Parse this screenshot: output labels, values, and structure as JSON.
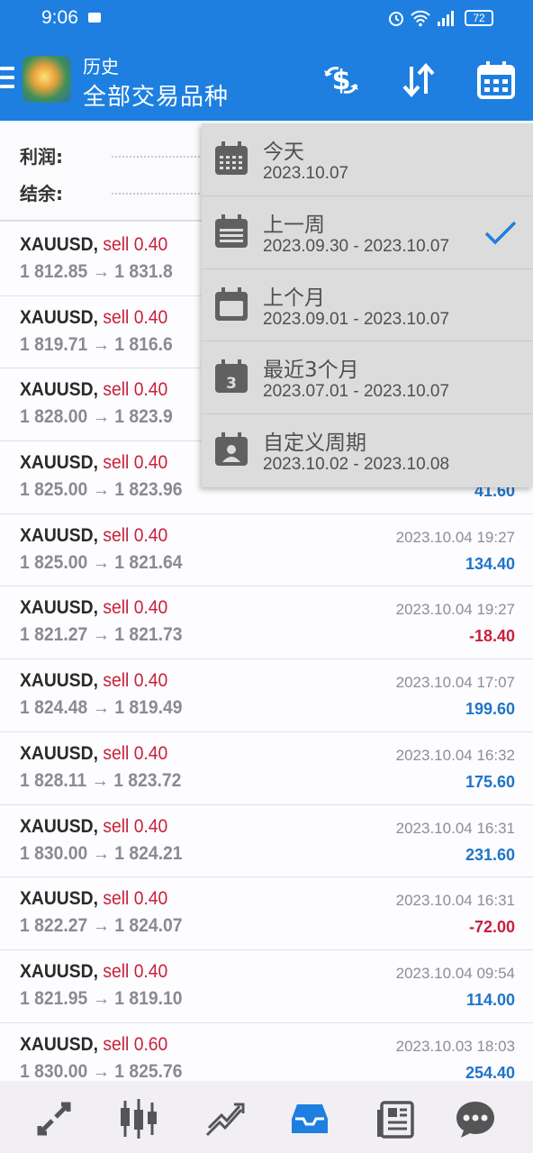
{
  "status_bar": {
    "time": "9:06",
    "battery": "72"
  },
  "header": {
    "subtitle": "历史",
    "title": "全部交易品种",
    "accent": "#1e7fe0"
  },
  "summary": {
    "profit_label": "利润:",
    "balance_label": "结余:"
  },
  "trades": [
    {
      "symbol": "XAUUSD,",
      "side": "sell 0.40",
      "prices": "1 812.85 → 1 831.8",
      "time": "",
      "profit": "",
      "sign": "pos"
    },
    {
      "symbol": "XAUUSD,",
      "side": "sell 0.40",
      "prices": "1 819.71 → 1 816.6",
      "time": "",
      "profit": "",
      "sign": "pos"
    },
    {
      "symbol": "XAUUSD,",
      "side": "sell 0.40",
      "prices": "1 828.00 → 1 823.9",
      "time": "",
      "profit": "",
      "sign": "pos"
    },
    {
      "symbol": "XAUUSD,",
      "side": "sell 0.40",
      "prices": "1 825.00 → 1 823.96",
      "time": "",
      "profit": "41.60",
      "sign": "pos"
    },
    {
      "symbol": "XAUUSD,",
      "side": "sell 0.40",
      "prices": "1 825.00 → 1 821.64",
      "time": "2023.10.04 19:27",
      "profit": "134.40",
      "sign": "pos"
    },
    {
      "symbol": "XAUUSD,",
      "side": "sell 0.40",
      "prices": "1 821.27 → 1 821.73",
      "time": "2023.10.04 19:27",
      "profit": "-18.40",
      "sign": "neg"
    },
    {
      "symbol": "XAUUSD,",
      "side": "sell 0.40",
      "prices": "1 824.48 → 1 819.49",
      "time": "2023.10.04 17:07",
      "profit": "199.60",
      "sign": "pos"
    },
    {
      "symbol": "XAUUSD,",
      "side": "sell 0.40",
      "prices": "1 828.11 → 1 823.72",
      "time": "2023.10.04 16:32",
      "profit": "175.60",
      "sign": "pos"
    },
    {
      "symbol": "XAUUSD,",
      "side": "sell 0.40",
      "prices": "1 830.00 → 1 824.21",
      "time": "2023.10.04 16:31",
      "profit": "231.60",
      "sign": "pos"
    },
    {
      "symbol": "XAUUSD,",
      "side": "sell 0.40",
      "prices": "1 822.27 → 1 824.07",
      "time": "2023.10.04 16:31",
      "profit": "-72.00",
      "sign": "neg"
    },
    {
      "symbol": "XAUUSD,",
      "side": "sell 0.40",
      "prices": "1 821.95 → 1 819.10",
      "time": "2023.10.04 09:54",
      "profit": "114.00",
      "sign": "pos"
    },
    {
      "symbol": "XAUUSD,",
      "side": "sell 0.60",
      "prices": "1 830.00 → 1 825.76",
      "time": "2023.10.03 18:03",
      "profit": "254.40",
      "sign": "pos"
    }
  ],
  "period_menu": {
    "selected_index": 1,
    "options": [
      {
        "label": "今天",
        "range": "2023.10.07",
        "icon": "calendar-day-icon"
      },
      {
        "label": "上一周",
        "range": "2023.09.30 - 2023.10.07",
        "icon": "calendar-week-icon"
      },
      {
        "label": "上个月",
        "range": "2023.09.01 - 2023.10.07",
        "icon": "calendar-month-icon"
      },
      {
        "label": "最近3个月",
        "range": "2023.07.01 - 2023.10.07",
        "icon": "calendar-3-icon",
        "icon_text": "3"
      },
      {
        "label": "自定义周期",
        "range": "2023.10.02 - 2023.10.08",
        "icon": "calendar-custom-icon"
      }
    ]
  },
  "bottom_nav": [
    {
      "name": "quotes-icon"
    },
    {
      "name": "chart-icon"
    },
    {
      "name": "trade-icon"
    },
    {
      "name": "history-icon",
      "active": true
    },
    {
      "name": "news-icon"
    },
    {
      "name": "chat-icon"
    }
  ]
}
